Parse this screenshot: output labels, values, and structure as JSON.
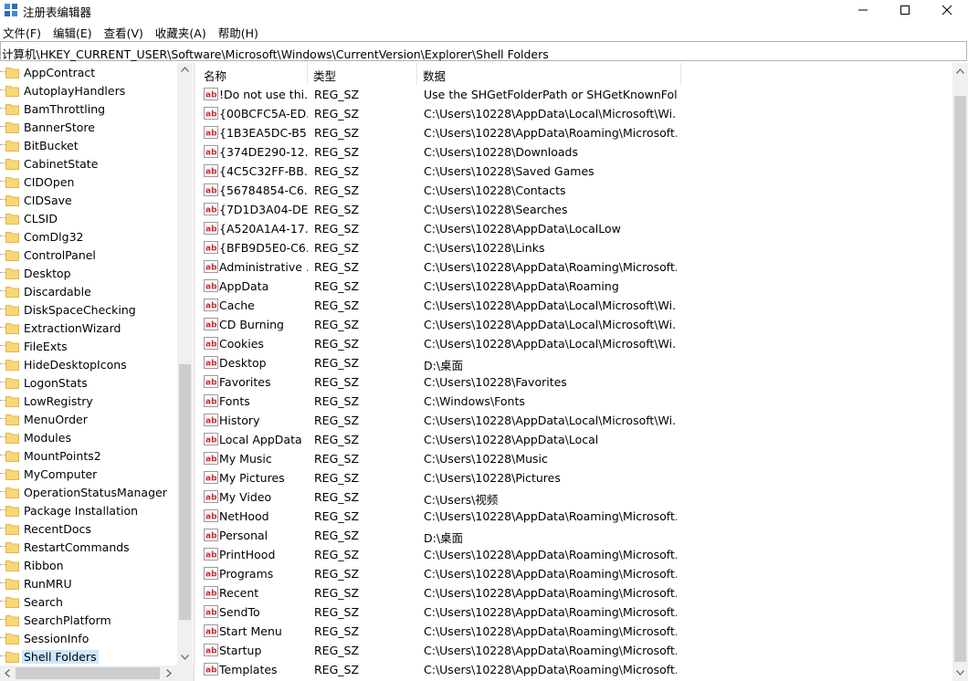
{
  "window": {
    "title": "注册表编辑器",
    "minimize_icon": "minimize-icon",
    "maximize_icon": "maximize-icon",
    "close_icon": "close-icon"
  },
  "menu": [
    "文件(F)",
    "编辑(E)",
    "查看(V)",
    "收藏夹(A)",
    "帮助(H)"
  ],
  "address": "计算机\\HKEY_CURRENT_USER\\Software\\Microsoft\\Windows\\CurrentVersion\\Explorer\\Shell Folders",
  "tree": {
    "items": [
      "AppContract",
      "AutoplayHandlers",
      "BamThrottling",
      "BannerStore",
      "BitBucket",
      "CabinetState",
      "CIDOpen",
      "CIDSave",
      "CLSID",
      "ComDlg32",
      "ControlPanel",
      "Desktop",
      "Discardable",
      "DiskSpaceChecking",
      "ExtractionWizard",
      "FileExts",
      "HideDesktopIcons",
      "LogonStats",
      "LowRegistry",
      "MenuOrder",
      "Modules",
      "MountPoints2",
      "MyComputer",
      "OperationStatusManager",
      "Package Installation",
      "RecentDocs",
      "RestartCommands",
      "Ribbon",
      "RunMRU",
      "Search",
      "SearchPlatform",
      "SessionInfo",
      "Shell Folders"
    ],
    "selected": "Shell Folders",
    "colors": {
      "folder": "#f8d775",
      "folder_edge": "#e0b84a",
      "selected_bg": "#cce8ff"
    }
  },
  "columns": {
    "name": "名称",
    "type": "类型",
    "data": "数据"
  },
  "values": [
    {
      "name": "!Do not use thi...",
      "type": "REG_SZ",
      "data": "Use the SHGetFolderPath or SHGetKnownFold..."
    },
    {
      "name": "{00BCFC5A-ED...",
      "type": "REG_SZ",
      "data": "C:\\Users\\10228\\AppData\\Local\\Microsoft\\Wi..."
    },
    {
      "name": "{1B3EA5DC-B5...",
      "type": "REG_SZ",
      "data": "C:\\Users\\10228\\AppData\\Roaming\\Microsoft..."
    },
    {
      "name": "{374DE290-12...",
      "type": "REG_SZ",
      "data": "C:\\Users\\10228\\Downloads"
    },
    {
      "name": "{4C5C32FF-BB...",
      "type": "REG_SZ",
      "data": "C:\\Users\\10228\\Saved Games"
    },
    {
      "name": "{56784854-C6...",
      "type": "REG_SZ",
      "data": "C:\\Users\\10228\\Contacts"
    },
    {
      "name": "{7D1D3A04-DE...",
      "type": "REG_SZ",
      "data": "C:\\Users\\10228\\Searches"
    },
    {
      "name": "{A520A1A4-17...",
      "type": "REG_SZ",
      "data": "C:\\Users\\10228\\AppData\\LocalLow"
    },
    {
      "name": "{BFB9D5E0-C6...",
      "type": "REG_SZ",
      "data": "C:\\Users\\10228\\Links"
    },
    {
      "name": "Administrative ...",
      "type": "REG_SZ",
      "data": "C:\\Users\\10228\\AppData\\Roaming\\Microsoft..."
    },
    {
      "name": "AppData",
      "type": "REG_SZ",
      "data": "C:\\Users\\10228\\AppData\\Roaming"
    },
    {
      "name": "Cache",
      "type": "REG_SZ",
      "data": "C:\\Users\\10228\\AppData\\Local\\Microsoft\\Wi..."
    },
    {
      "name": "CD Burning",
      "type": "REG_SZ",
      "data": "C:\\Users\\10228\\AppData\\Local\\Microsoft\\Wi..."
    },
    {
      "name": "Cookies",
      "type": "REG_SZ",
      "data": "C:\\Users\\10228\\AppData\\Local\\Microsoft\\Wi..."
    },
    {
      "name": "Desktop",
      "type": "REG_SZ",
      "data": "D:\\桌面"
    },
    {
      "name": "Favorites",
      "type": "REG_SZ",
      "data": "C:\\Users\\10228\\Favorites"
    },
    {
      "name": "Fonts",
      "type": "REG_SZ",
      "data": "C:\\Windows\\Fonts"
    },
    {
      "name": "History",
      "type": "REG_SZ",
      "data": "C:\\Users\\10228\\AppData\\Local\\Microsoft\\Wi..."
    },
    {
      "name": "Local AppData",
      "type": "REG_SZ",
      "data": "C:\\Users\\10228\\AppData\\Local"
    },
    {
      "name": "My Music",
      "type": "REG_SZ",
      "data": "C:\\Users\\10228\\Music"
    },
    {
      "name": "My Pictures",
      "type": "REG_SZ",
      "data": "C:\\Users\\10228\\Pictures"
    },
    {
      "name": "My Video",
      "type": "REG_SZ",
      "data": "C:\\Users\\视频"
    },
    {
      "name": "NetHood",
      "type": "REG_SZ",
      "data": "C:\\Users\\10228\\AppData\\Roaming\\Microsoft..."
    },
    {
      "name": "Personal",
      "type": "REG_SZ",
      "data": "D:\\桌面"
    },
    {
      "name": "PrintHood",
      "type": "REG_SZ",
      "data": "C:\\Users\\10228\\AppData\\Roaming\\Microsoft..."
    },
    {
      "name": "Programs",
      "type": "REG_SZ",
      "data": "C:\\Users\\10228\\AppData\\Roaming\\Microsoft..."
    },
    {
      "name": "Recent",
      "type": "REG_SZ",
      "data": "C:\\Users\\10228\\AppData\\Roaming\\Microsoft..."
    },
    {
      "name": "SendTo",
      "type": "REG_SZ",
      "data": "C:\\Users\\10228\\AppData\\Roaming\\Microsoft..."
    },
    {
      "name": "Start Menu",
      "type": "REG_SZ",
      "data": "C:\\Users\\10228\\AppData\\Roaming\\Microsoft..."
    },
    {
      "name": "Startup",
      "type": "REG_SZ",
      "data": "C:\\Users\\10228\\AppData\\Roaming\\Microsoft..."
    },
    {
      "name": "Templates",
      "type": "REG_SZ",
      "data": "C:\\Users\\10228\\AppData\\Roaming\\Microsoft..."
    }
  ],
  "value_icon": "reg-sz-value-icon",
  "colors": {
    "value_icon_red": "#c8282d",
    "address_border": "#b4b4b4",
    "scrollbar": "#f0f0f0",
    "scroll_thumb": "#cdcdcd"
  }
}
